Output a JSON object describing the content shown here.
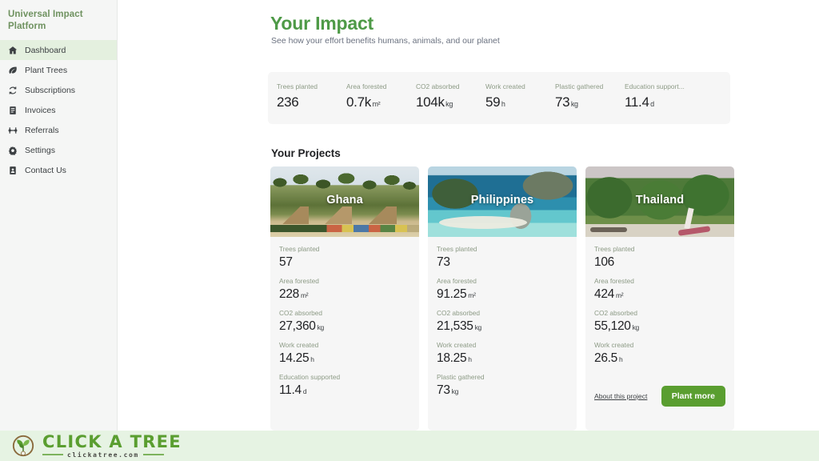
{
  "sidebar": {
    "brand": "Universal Impact Platform",
    "items": [
      {
        "label": "Dashboard",
        "icon": "home-icon",
        "active": true
      },
      {
        "label": "Plant Trees",
        "icon": "leaf-icon",
        "active": false
      },
      {
        "label": "Subscriptions",
        "icon": "refresh-icon",
        "active": false
      },
      {
        "label": "Invoices",
        "icon": "invoice-icon",
        "active": false
      },
      {
        "label": "Referrals",
        "icon": "referrals-icon",
        "active": false
      },
      {
        "label": "Settings",
        "icon": "gear-icon",
        "active": false
      },
      {
        "label": "Contact Us",
        "icon": "contact-book-icon",
        "active": false
      }
    ]
  },
  "header": {
    "title": "Your Impact",
    "subtitle": "See how your effort benefits humans, animals, and our planet",
    "title_color": "#4e9a47"
  },
  "stats": [
    {
      "label": "Trees planted",
      "value": "236",
      "unit": ""
    },
    {
      "label": "Area forested",
      "value": "0.7k",
      "unit": "m²"
    },
    {
      "label": "CO2 absorbed",
      "value": "104k",
      "unit": "kg"
    },
    {
      "label": "Work created",
      "value": "59",
      "unit": "h"
    },
    {
      "label": "Plastic gathered",
      "value": "73",
      "unit": "kg"
    },
    {
      "label": "Education support...",
      "value": "11.4",
      "unit": "d"
    }
  ],
  "projects": {
    "title": "Your Projects",
    "cards": [
      {
        "name": "Ghana",
        "image": "ghana-beach-palm-trees-photo",
        "metrics": [
          {
            "label": "Trees planted",
            "value": "57",
            "unit": ""
          },
          {
            "label": "Area forested",
            "value": "228",
            "unit": "m²"
          },
          {
            "label": "CO2 absorbed",
            "value": "27,360",
            "unit": "kg"
          },
          {
            "label": "Work created",
            "value": "14.25",
            "unit": "h"
          },
          {
            "label": "Education supported",
            "value": "11.4",
            "unit": "d"
          }
        ],
        "show_actions": false
      },
      {
        "name": "Philippines",
        "image": "philippines-lagoon-cliffs-photo",
        "metrics": [
          {
            "label": "Trees planted",
            "value": "73",
            "unit": ""
          },
          {
            "label": "Area forested",
            "value": "91.25",
            "unit": "m²"
          },
          {
            "label": "CO2 absorbed",
            "value": "21,535",
            "unit": "kg"
          },
          {
            "label": "Work created",
            "value": "18.25",
            "unit": "h"
          },
          {
            "label": "Plastic gathered",
            "value": "73",
            "unit": "kg"
          }
        ],
        "show_actions": false
      },
      {
        "name": "Thailand",
        "image": "thailand-karst-longtail-boats-photo",
        "metrics": [
          {
            "label": "Trees planted",
            "value": "106",
            "unit": ""
          },
          {
            "label": "Area forested",
            "value": "424",
            "unit": "m²"
          },
          {
            "label": "CO2 absorbed",
            "value": "55,120",
            "unit": "kg"
          },
          {
            "label": "Work created",
            "value": "26.5",
            "unit": "h"
          }
        ],
        "show_actions": true,
        "about_link": "About this project",
        "plant_button": "Plant more"
      }
    ]
  },
  "footer": {
    "logo_main": "CLICK A TREE",
    "logo_sub": "clickatree.com",
    "logo_color": "#5a9e30",
    "background": "#e6f3e3"
  }
}
